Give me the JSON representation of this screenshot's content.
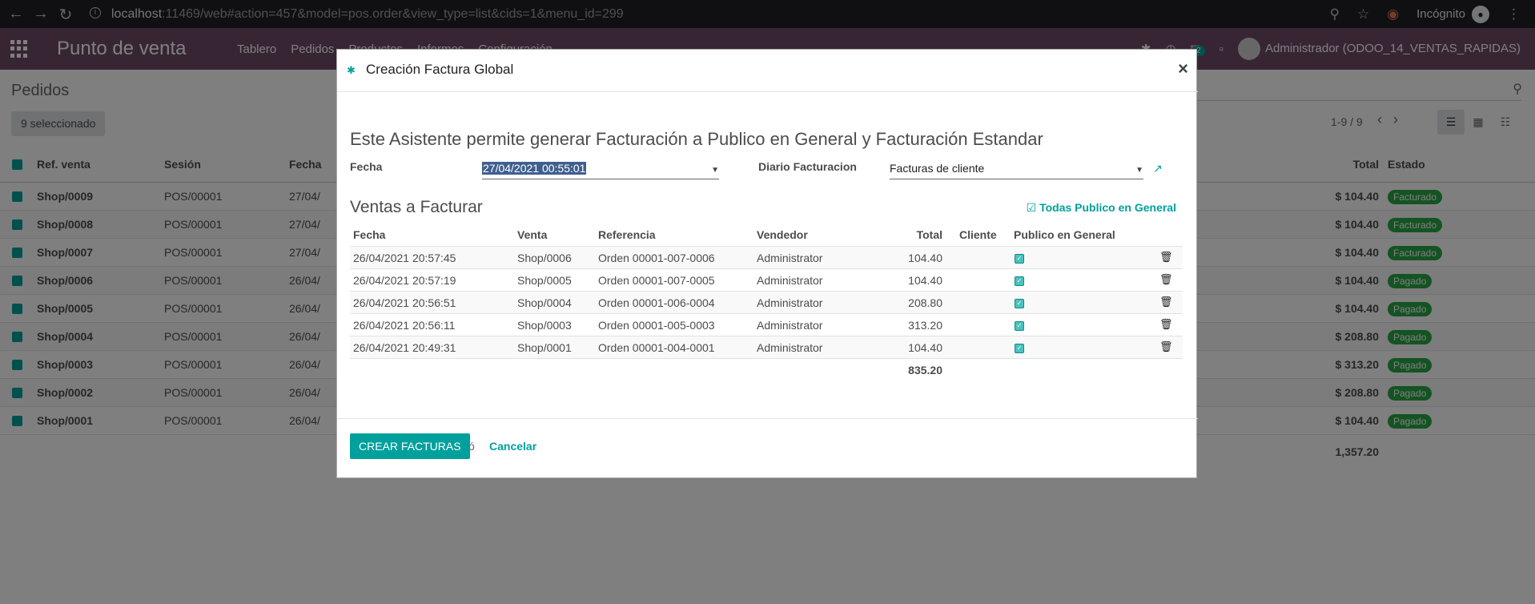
{
  "browser": {
    "url_host": "localhost",
    "url_path": ":11469/web#action=457&model=pos.order&view_type=list&cids=1&menu_id=299",
    "incognito_label": "Incógnito"
  },
  "app": {
    "title": "Punto de venta",
    "menu": [
      "Tablero",
      "Pedidos",
      "Productos",
      "Informes",
      "Configuración"
    ],
    "notification_count": "2",
    "user": "Administrador (ODOO_14_VENTAS_RAPIDAS)"
  },
  "control": {
    "breadcrumb": "Pedidos",
    "selected_label": "9 seleccionado",
    "pager": "1-9 / 9"
  },
  "list": {
    "headers": [
      "Ref. venta",
      "Sesión",
      "Fecha",
      "Total",
      "Estado"
    ],
    "rows": [
      {
        "ref": "Shop/0009",
        "session": "POS/00001",
        "date": "27/04/",
        "total": "$ 104.40",
        "state": "Facturado"
      },
      {
        "ref": "Shop/0008",
        "session": "POS/00001",
        "date": "27/04/",
        "total": "$ 104.40",
        "state": "Facturado"
      },
      {
        "ref": "Shop/0007",
        "session": "POS/00001",
        "date": "27/04/",
        "total": "$ 104.40",
        "state": "Facturado"
      },
      {
        "ref": "Shop/0006",
        "session": "POS/00001",
        "date": "26/04/",
        "total": "$ 104.40",
        "state": "Pagado"
      },
      {
        "ref": "Shop/0005",
        "session": "POS/00001",
        "date": "26/04/",
        "total": "$ 104.40",
        "state": "Pagado"
      },
      {
        "ref": "Shop/0004",
        "session": "POS/00001",
        "date": "26/04/",
        "total": "$ 208.80",
        "state": "Pagado"
      },
      {
        "ref": "Shop/0003",
        "session": "POS/00001",
        "date": "26/04/",
        "total": "$ 313.20",
        "state": "Pagado"
      },
      {
        "ref": "Shop/0002",
        "session": "POS/00001",
        "date": "26/04/",
        "total": "$ 208.80",
        "state": "Pagado"
      },
      {
        "ref": "Shop/0001",
        "session": "POS/00001",
        "date": "26/04/",
        "total": "$ 104.40",
        "state": "Pagado"
      }
    ],
    "sum_total": "1,357.20"
  },
  "modal": {
    "title": "Creación Factura Global",
    "intro": "Este Asistente permite generar Facturación a Publico en General y Facturación Estandar",
    "fecha_label": "Fecha",
    "fecha_value": "27/04/2021 00:55:01",
    "diario_label": "Diario Facturacion",
    "diario_value": "Facturas de cliente",
    "section_title": "Ventas a Facturar",
    "todas_label": "Todas Publico en General",
    "columns": [
      "Fecha",
      "Venta",
      "Referencia",
      "Vendedor",
      "Total",
      "Cliente",
      "Publico en General"
    ],
    "lines": [
      {
        "fecha": "26/04/2021 20:57:45",
        "venta": "Shop/0006",
        "referencia": "Orden 00001-007-0006",
        "vendedor": "Administrator",
        "total": "104.40"
      },
      {
        "fecha": "26/04/2021 20:57:19",
        "venta": "Shop/0005",
        "referencia": "Orden 00001-007-0005",
        "vendedor": "Administrator",
        "total": "104.40"
      },
      {
        "fecha": "26/04/2021 20:56:51",
        "venta": "Shop/0004",
        "referencia": "Orden 00001-006-0004",
        "vendedor": "Administrator",
        "total": "208.80"
      },
      {
        "fecha": "26/04/2021 20:56:11",
        "venta": "Shop/0003",
        "referencia": "Orden 00001-005-0003",
        "vendedor": "Administrator",
        "total": "313.20"
      },
      {
        "fecha": "26/04/2021 20:49:31",
        "venta": "Shop/0001",
        "referencia": "Orden 00001-004-0001",
        "vendedor": "Administrator",
        "total": "104.40"
      }
    ],
    "lines_total": "835.20",
    "primary_button": "CREAR FACTURAS",
    "or_text": "ó",
    "cancel_label": "Cancelar"
  },
  "colors": {
    "brand": "#714b67",
    "accent": "#00a09d",
    "state_badge": "#28a745"
  }
}
